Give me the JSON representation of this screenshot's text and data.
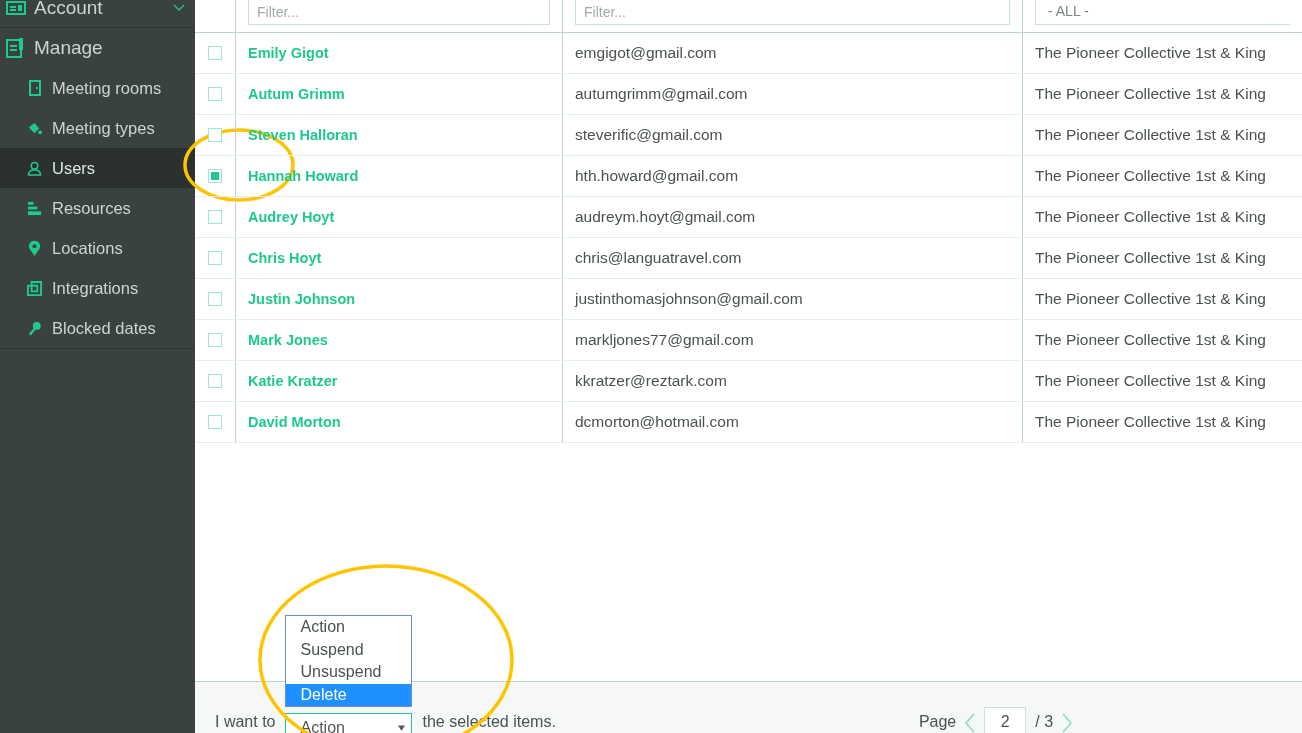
{
  "sidebar": {
    "account": {
      "label": "Account"
    },
    "manage": {
      "label": "Manage"
    },
    "items": [
      {
        "label": "Meeting rooms",
        "selected": false
      },
      {
        "label": "Meeting types",
        "selected": false
      },
      {
        "label": "Users",
        "selected": true
      },
      {
        "label": "Resources",
        "selected": false
      },
      {
        "label": "Locations",
        "selected": false
      },
      {
        "label": "Integrations",
        "selected": false
      },
      {
        "label": "Blocked dates",
        "selected": false
      }
    ]
  },
  "table": {
    "filters": [
      {
        "kind": "text",
        "placeholder": "Filter..."
      },
      {
        "kind": "text",
        "placeholder": "Filter..."
      },
      {
        "kind": "select",
        "value": "- ALL -"
      }
    ],
    "rows": [
      {
        "checked": false,
        "name": "Emily Gigot",
        "email": "emgigot@gmail.com",
        "location": "The Pioneer Collective 1st & King"
      },
      {
        "checked": false,
        "name": "Autum Grimm",
        "email": "autumgrimm@gmail.com",
        "location": "The Pioneer Collective 1st & King"
      },
      {
        "checked": false,
        "name": "Steven Halloran",
        "email": "steverific@gmail.com",
        "location": "The Pioneer Collective 1st & King"
      },
      {
        "checked": true,
        "name": "Hannah Howard",
        "email": "hth.howard@gmail.com",
        "location": "The Pioneer Collective 1st & King"
      },
      {
        "checked": false,
        "name": "Audrey Hoyt",
        "email": "audreym.hoyt@gmail.com",
        "location": "The Pioneer Collective 1st & King"
      },
      {
        "checked": false,
        "name": "Chris Hoyt",
        "email": "chris@languatravel.com",
        "location": "The Pioneer Collective 1st & King"
      },
      {
        "checked": false,
        "name": "Justin Johnson",
        "email": "justinthomasjohnson@gmail.com",
        "location": "The Pioneer Collective 1st & King"
      },
      {
        "checked": false,
        "name": "Mark Jones",
        "email": "markljones77@gmail.com",
        "location": "The Pioneer Collective 1st & King"
      },
      {
        "checked": false,
        "name": "Katie Kratzer",
        "email": "kkratzer@reztark.com",
        "location": "The Pioneer Collective 1st & King"
      },
      {
        "checked": false,
        "name": "David Morton",
        "email": "dcmorton@hotmail.com",
        "location": "The Pioneer Collective 1st & King"
      }
    ]
  },
  "footer": {
    "text_before": "I want to",
    "select_value": "Action",
    "text_after": "the selected items.",
    "options": [
      {
        "label": "Action",
        "selected": false
      },
      {
        "label": "Suspend",
        "selected": false
      },
      {
        "label": "Unsuspend",
        "selected": false
      },
      {
        "label": "Delete",
        "selected": true
      }
    ],
    "pagination": {
      "label": "Page",
      "current": "2",
      "total": "/ 3"
    }
  }
}
